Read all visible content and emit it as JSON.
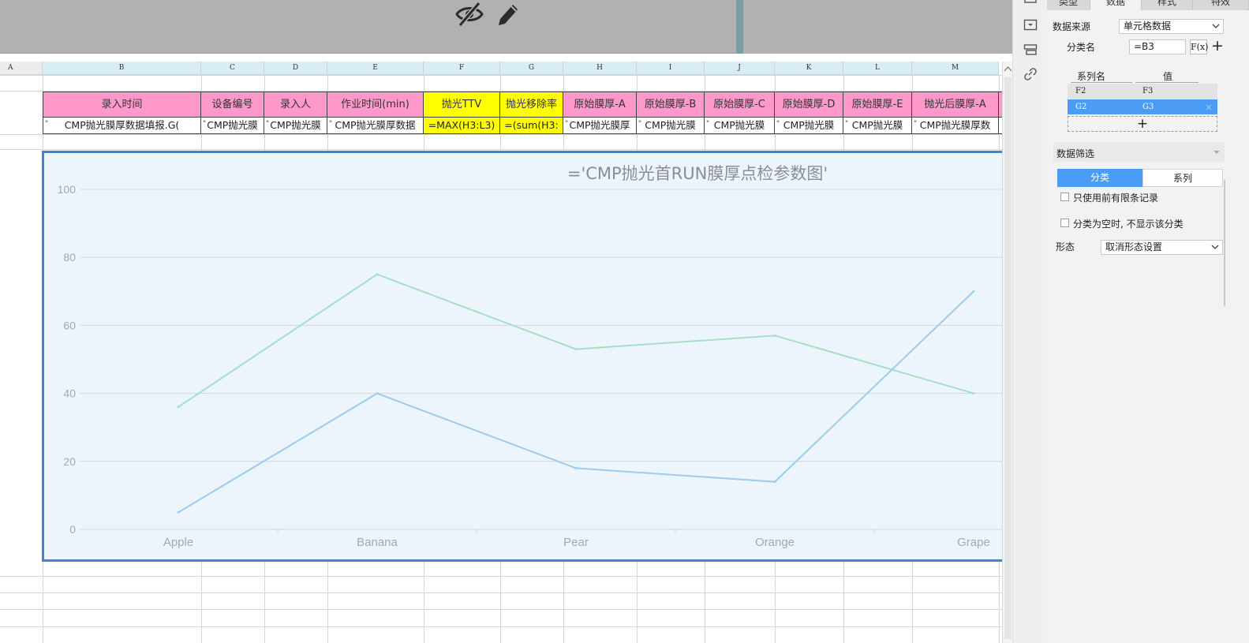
{
  "toolbar": {
    "hide_icon": "eye-off-icon",
    "edit_icon": "pencil-icon"
  },
  "sheet": {
    "columns": [
      "A",
      "B",
      "C",
      "D",
      "E",
      "F",
      "G",
      "H",
      "I",
      "J",
      "K",
      "L",
      "M"
    ],
    "header_row": [
      "录入时间",
      "设备编号",
      "录入人",
      "作业时间(min)",
      "抛光TTV",
      "抛光移除率",
      "原始膜厚-A",
      "原始膜厚-B",
      "原始膜厚-C",
      "原始膜厚-D",
      "原始膜厚-E",
      "抛光后膜厚-A"
    ],
    "data_row": [
      "CMP抛光膜厚数据填报.G(",
      "CMP抛光膜",
      "CMP抛光膜",
      "CMP抛光膜厚数据",
      "=MAX(H3:L3)",
      "=(sum(H3:",
      "CMP抛光膜厚",
      "CMP抛光膜",
      "CMP抛光膜",
      "CMP抛光膜",
      "CMP抛光膜",
      "CMP抛光膜厚数"
    ],
    "data_row_marks": [
      "\"",
      "\"",
      "\"",
      "\"",
      "",
      "",
      "\"",
      "\"",
      "\"",
      "\"",
      "\"",
      "\""
    ]
  },
  "chart_data": {
    "type": "line",
    "title": "='CMP抛光首RUN膜厚点检参数图'",
    "categories": [
      "Apple",
      "Banana",
      "Pear",
      "Orange",
      "Grape"
    ],
    "series": [
      {
        "values": [
          36,
          75,
          53,
          57,
          40
        ],
        "color": "#a6dfc4"
      },
      {
        "values": [
          5,
          40,
          18,
          14,
          70
        ],
        "color": "#9ccbec"
      }
    ],
    "ylim": [
      0,
      100
    ],
    "yticks": [
      "0",
      "20",
      "40",
      "60",
      "80",
      "100"
    ],
    "grid": true,
    "background": "#edf5fc"
  },
  "panel": {
    "tabs": [
      "类型",
      "数据",
      "样式",
      "特效"
    ],
    "active_tab": "数据",
    "data_source_label": "数据来源",
    "data_source_value": "单元格数据",
    "category_label": "分类名",
    "category_value": "=B3",
    "fx_label": "F(x)",
    "add_label": "+",
    "series_header_name": "系列名",
    "series_header_value": "值",
    "series_rows": [
      {
        "name": "F2",
        "value": "F3"
      },
      {
        "name": "G2",
        "value": "G3"
      }
    ],
    "series_add": "+",
    "filter_label": "数据筛选",
    "filter_tabs": [
      "分类",
      "系列"
    ],
    "opt_limit": "只使用前有限条记录",
    "opt_empty": "分类为空时, 不显示该分类",
    "form_label": "形态",
    "form_value": "取消形态设置",
    "accent": "#4a9cf4"
  }
}
